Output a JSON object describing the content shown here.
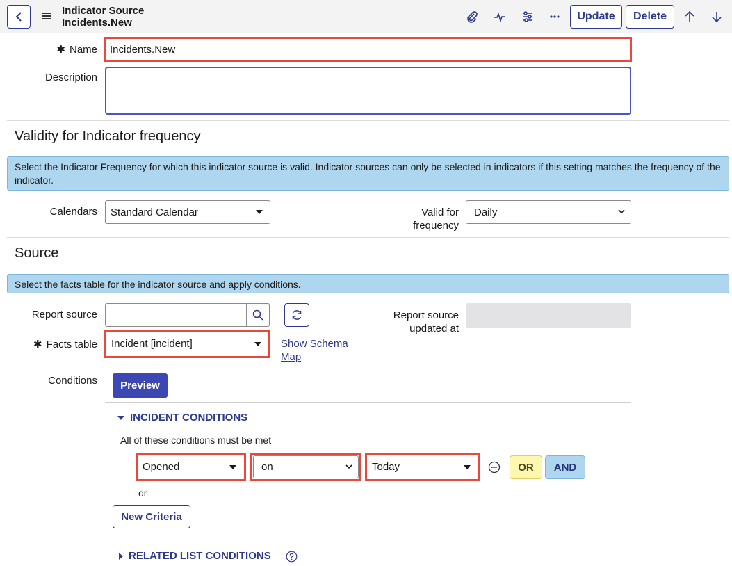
{
  "header": {
    "title_line1": "Indicator Source",
    "title_line2": "Incidents.New",
    "update_label": "Update",
    "delete_label": "Delete"
  },
  "form": {
    "name_label": "Name",
    "name_value": "Incidents.New",
    "description_label": "Description",
    "description_value": ""
  },
  "validity": {
    "title": "Validity for Indicator frequency",
    "info": "Select the Indicator Frequency for which this indicator source is valid. Indicator sources can only be selected in indicators if this setting matches the frequency of the indicator.",
    "calendars_label": "Calendars",
    "calendars_value": "Standard Calendar",
    "valid_for_label_1": "Valid for",
    "valid_for_label_2": "frequency",
    "valid_for_value": "Daily"
  },
  "source": {
    "title": "Source",
    "info": "Select the facts table for the indicator source and apply conditions.",
    "report_source_label": "Report source",
    "report_source_value": "",
    "report_updated_label_1": "Report source",
    "report_updated_label_2": "updated at",
    "facts_table_label": "Facts table",
    "facts_table_value": "Incident [incident]",
    "schema_link_1": "Show Schema",
    "schema_link_2": "Map",
    "conditions_label": "Conditions",
    "preview_label": "Preview"
  },
  "conditions": {
    "incident_header": "INCIDENT CONDITIONS",
    "all_met_text": "All of these conditions must be met",
    "field_value": "Opened",
    "operator_value": "on",
    "value_value": "Today",
    "or_label": "OR",
    "and_label": "AND",
    "or_separator": "or",
    "new_criteria_label": "New Criteria",
    "related_header": "RELATED LIST CONDITIONS"
  },
  "colors": {
    "accent": "#2e3a8c",
    "highlight_red": "#e9483d",
    "info_bg": "#afd6ef",
    "or_bg": "#fdf7b0",
    "and_bg": "#afd6ef"
  }
}
